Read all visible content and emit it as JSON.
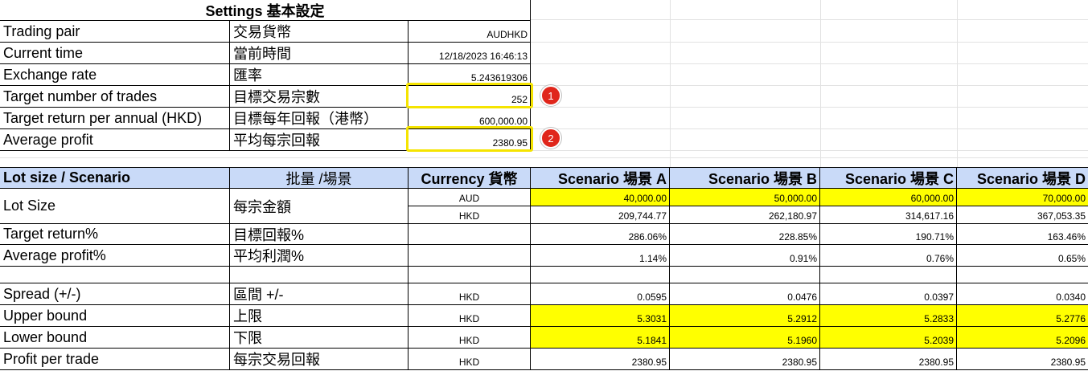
{
  "settings": {
    "title": "Settings 基本設定",
    "rows": [
      {
        "en": "Trading pair",
        "zh": "交易貨幣",
        "value": "AUDHKD"
      },
      {
        "en": "Current time",
        "zh": "當前時間",
        "value": "12/18/2023 16:46:13"
      },
      {
        "en": "Exchange rate",
        "zh": "匯率",
        "value": "5.243619306"
      },
      {
        "en": "Target number of trades",
        "zh": "目標交易宗數",
        "value": "252"
      },
      {
        "en": "Target return per annual (HKD)",
        "zh": "目標每年回報（港幣）",
        "value": "600,000.00"
      },
      {
        "en": "Average profit",
        "zh": "平均每宗回報",
        "value": "2380.95"
      }
    ]
  },
  "markers": [
    "1",
    "2"
  ],
  "scenario_table": {
    "headers": [
      "Lot size / Scenario",
      "批量 /場景",
      "Currency 貨幣",
      "Scenario 場景 A",
      "Scenario 場景 B",
      "Scenario 場景 C",
      "Scenario 場景 D"
    ],
    "lot_size": {
      "en": "Lot Size",
      "zh": "每宗金額",
      "aud": {
        "currency": "AUD",
        "values": [
          "40,000.00",
          "50,000.00",
          "60,000.00",
          "70,000.00"
        ]
      },
      "hkd": {
        "currency": "HKD",
        "values": [
          "209,744.77",
          "262,180.97",
          "314,617.16",
          "367,053.35"
        ]
      }
    },
    "target_return": {
      "en": "Target return%",
      "zh": "目標回報%",
      "currency": "",
      "values": [
        "286.06%",
        "228.85%",
        "190.71%",
        "163.46%"
      ]
    },
    "average_profit": {
      "en": "Average profit%",
      "zh": "平均利潤%",
      "currency": "",
      "values": [
        "1.14%",
        "0.91%",
        "0.76%",
        "0.65%"
      ]
    },
    "spread": {
      "en": "Spread (+/-)",
      "zh": "區間 +/-",
      "currency": "HKD",
      "values": [
        "0.0595",
        "0.0476",
        "0.0397",
        "0.0340"
      ]
    },
    "upper_bound": {
      "en": "Upper bound",
      "zh": "上限",
      "currency": "HKD",
      "values": [
        "5.3031",
        "5.2912",
        "5.2833",
        "5.2776"
      ]
    },
    "lower_bound": {
      "en": "Lower bound",
      "zh": "下限",
      "currency": "HKD",
      "values": [
        "5.1841",
        "5.1960",
        "5.2039",
        "5.2096"
      ]
    },
    "profit_per_trade": {
      "en": "Profit per trade",
      "zh": "每宗交易回報",
      "currency": "HKD",
      "values": [
        "2380.95",
        "2380.95",
        "2380.95",
        "2380.95"
      ]
    }
  },
  "colors": {
    "header_bg": "#c9daf8",
    "highlight": "#ffff00",
    "callout_box": "#f5e400",
    "marker": "#e0261b"
  }
}
